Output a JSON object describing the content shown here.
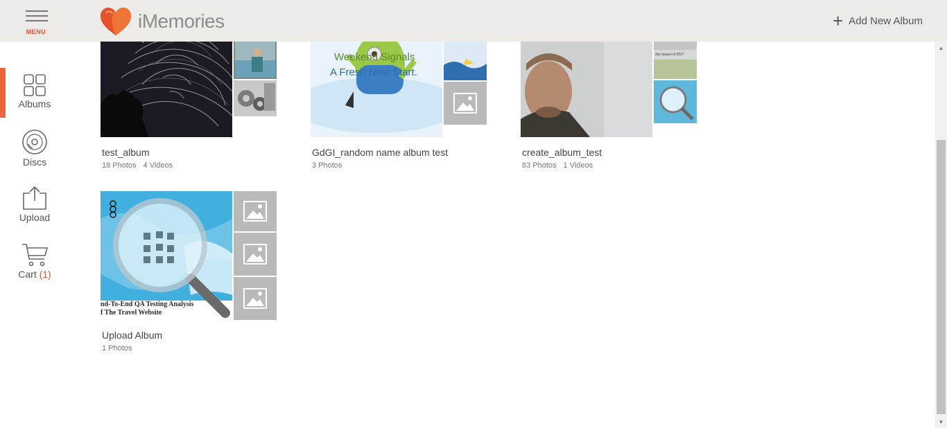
{
  "header": {
    "menu_label": "MENU",
    "logo_text": "iMemories",
    "add_album_label": "Add New Album"
  },
  "sidebar": {
    "items": [
      {
        "label": "Albums",
        "icon": "grid-icon",
        "active": true
      },
      {
        "label": "Discs",
        "icon": "disc-icon"
      },
      {
        "label": "Upload",
        "icon": "upload-icon"
      },
      {
        "label": "Cart",
        "icon": "cart-icon",
        "count": "(1)"
      }
    ]
  },
  "albums": [
    {
      "name": "test_album",
      "photos": "18 Photos",
      "videos": "4 Videos"
    },
    {
      "name": "GdGI_random name album test",
      "photos": "3 Photos",
      "caption_line1": "Weekend Signals",
      "caption_line2": "A Fresh New Start."
    },
    {
      "name": "create_album_test",
      "photos": "83 Photos",
      "videos": "1 Videos"
    },
    {
      "name": "Upload Album",
      "photos": "1 Photos",
      "caption_line1": "nd-To-End QA Testing Analysis",
      "caption_line2": "f The Travel Website"
    }
  ],
  "colors": {
    "accent": "#e8643a",
    "header_bg": "#edebe8",
    "placeholder": "#b9b9b9"
  }
}
